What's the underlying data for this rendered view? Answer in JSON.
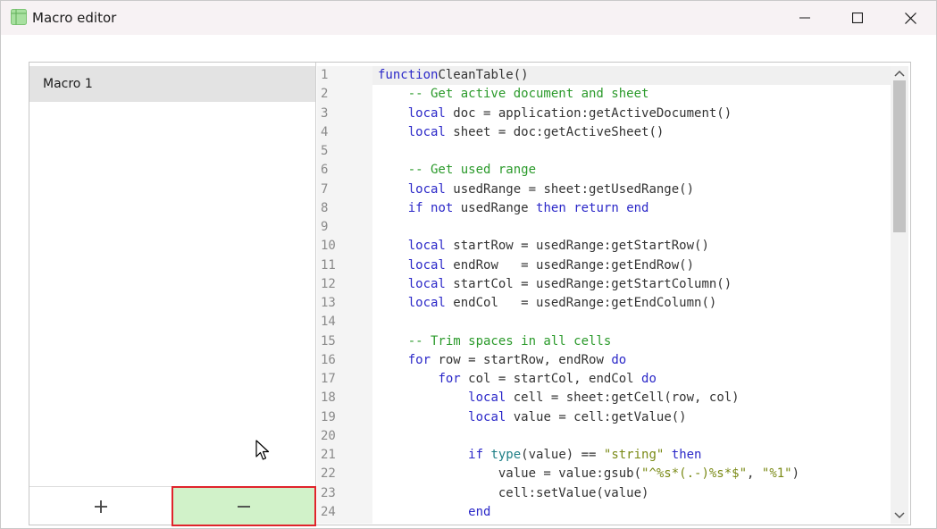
{
  "window": {
    "title": "Macro editor",
    "icons": {
      "app": "spreadsheet-app-icon",
      "minimize": "minimize-icon",
      "maximize": "maximize-icon",
      "close": "close-icon"
    }
  },
  "macros": {
    "items": [
      {
        "label": "Macro 1",
        "selected": true
      }
    ],
    "add_button": "+",
    "remove_button": "−"
  },
  "colors": {
    "keyword": "#2b28c8",
    "comment": "#2b9a2b",
    "string": "#7a8a16",
    "builtin": "#1f7f86",
    "remove_button_bg": "#d1f2c9",
    "highlight_border": "#e0242c"
  },
  "editor": {
    "lines": [
      {
        "n": "1",
        "tokens": [
          [
            "kw",
            "function"
          ],
          [
            "",
            "CleanTable()"
          ]
        ]
      },
      {
        "n": "2",
        "tokens": [
          [
            "",
            "    "
          ],
          [
            "cm",
            "-- Get active document and sheet"
          ]
        ]
      },
      {
        "n": "3",
        "tokens": [
          [
            "",
            "    "
          ],
          [
            "kw",
            "local"
          ],
          [
            "",
            " doc = application:getActiveDocument()"
          ]
        ]
      },
      {
        "n": "4",
        "tokens": [
          [
            "",
            "    "
          ],
          [
            "kw",
            "local"
          ],
          [
            "",
            " sheet = doc:getActiveSheet()"
          ]
        ]
      },
      {
        "n": "5",
        "tokens": []
      },
      {
        "n": "6",
        "tokens": [
          [
            "",
            "    "
          ],
          [
            "cm",
            "-- Get used range"
          ]
        ]
      },
      {
        "n": "7",
        "tokens": [
          [
            "",
            "    "
          ],
          [
            "kw",
            "local"
          ],
          [
            "",
            " usedRange = sheet:getUsedRange()"
          ]
        ]
      },
      {
        "n": "8",
        "tokens": [
          [
            "",
            "    "
          ],
          [
            "kw",
            "if"
          ],
          [
            "",
            " "
          ],
          [
            "kw",
            "not"
          ],
          [
            "",
            " usedRange "
          ],
          [
            "kw",
            "then"
          ],
          [
            "",
            " "
          ],
          [
            "kw",
            "return"
          ],
          [
            "",
            " "
          ],
          [
            "kw",
            "end"
          ]
        ]
      },
      {
        "n": "9",
        "tokens": []
      },
      {
        "n": "10",
        "tokens": [
          [
            "",
            "    "
          ],
          [
            "kw",
            "local"
          ],
          [
            "",
            " startRow = usedRange:getStartRow()"
          ]
        ]
      },
      {
        "n": "11",
        "tokens": [
          [
            "",
            "    "
          ],
          [
            "kw",
            "local"
          ],
          [
            "",
            " endRow   = usedRange:getEndRow()"
          ]
        ]
      },
      {
        "n": "12",
        "tokens": [
          [
            "",
            "    "
          ],
          [
            "kw",
            "local"
          ],
          [
            "",
            " startCol = usedRange:getStartColumn()"
          ]
        ]
      },
      {
        "n": "13",
        "tokens": [
          [
            "",
            "    "
          ],
          [
            "kw",
            "local"
          ],
          [
            "",
            " endCol   = usedRange:getEndColumn()"
          ]
        ]
      },
      {
        "n": "14",
        "tokens": []
      },
      {
        "n": "15",
        "tokens": [
          [
            "",
            "    "
          ],
          [
            "cm",
            "-- Trim spaces in all cells"
          ]
        ]
      },
      {
        "n": "16",
        "tokens": [
          [
            "",
            "    "
          ],
          [
            "kw",
            "for"
          ],
          [
            "",
            " row = startRow, endRow "
          ],
          [
            "kw",
            "do"
          ]
        ]
      },
      {
        "n": "17",
        "tokens": [
          [
            "",
            "        "
          ],
          [
            "kw",
            "for"
          ],
          [
            "",
            " col = startCol, endCol "
          ],
          [
            "kw",
            "do"
          ]
        ]
      },
      {
        "n": "18",
        "tokens": [
          [
            "",
            "            "
          ],
          [
            "kw",
            "local"
          ],
          [
            "",
            " cell = sheet:getCell(row, col)"
          ]
        ]
      },
      {
        "n": "19",
        "tokens": [
          [
            "",
            "            "
          ],
          [
            "kw",
            "local"
          ],
          [
            "",
            " value = cell:getValue()"
          ]
        ]
      },
      {
        "n": "20",
        "tokens": []
      },
      {
        "n": "21",
        "tokens": [
          [
            "",
            "            "
          ],
          [
            "kw",
            "if"
          ],
          [
            "",
            " "
          ],
          [
            "bi",
            "type"
          ],
          [
            "",
            "(value) == "
          ],
          [
            "st",
            "\"string\""
          ],
          [
            "",
            " "
          ],
          [
            "kw",
            "then"
          ]
        ]
      },
      {
        "n": "22",
        "tokens": [
          [
            "",
            "                value = value:gsub("
          ],
          [
            "st",
            "\"^%s*(.-)%s*$\""
          ],
          [
            "",
            ", "
          ],
          [
            "st",
            "\"%1\""
          ],
          [
            "",
            ")"
          ]
        ]
      },
      {
        "n": "23",
        "tokens": [
          [
            "",
            "                cell:setValue(value)"
          ]
        ]
      },
      {
        "n": "24",
        "tokens": [
          [
            "",
            "            "
          ],
          [
            "kw",
            "end"
          ]
        ]
      }
    ]
  }
}
